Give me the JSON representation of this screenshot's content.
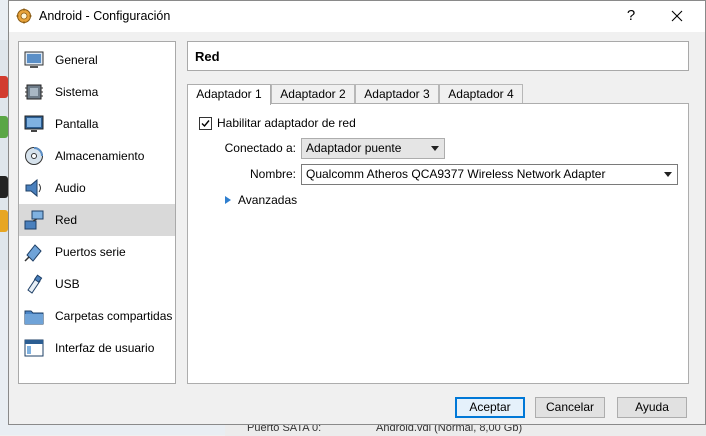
{
  "window": {
    "title": "Android - Configuración",
    "help_glyph": "?",
    "close_glyph": "✕"
  },
  "sidebar": {
    "items": [
      {
        "label": "General",
        "icon": "general-icon"
      },
      {
        "label": "Sistema",
        "icon": "chip-icon"
      },
      {
        "label": "Pantalla",
        "icon": "monitor-icon"
      },
      {
        "label": "Almacenamiento",
        "icon": "disk-icon"
      },
      {
        "label": "Audio",
        "icon": "speaker-icon"
      },
      {
        "label": "Red",
        "icon": "network-icon",
        "selected": true
      },
      {
        "label": "Puertos serie",
        "icon": "serial-port-icon"
      },
      {
        "label": "USB",
        "icon": "usb-icon"
      },
      {
        "label": "Carpetas compartidas",
        "icon": "folder-icon"
      },
      {
        "label": "Interfaz de usuario",
        "icon": "window-icon"
      }
    ]
  },
  "header": {
    "title": "Red"
  },
  "tabs": [
    {
      "label": "Adaptador 1",
      "active": true
    },
    {
      "label": "Adaptador 2"
    },
    {
      "label": "Adaptador 3"
    },
    {
      "label": "Adaptador 4"
    }
  ],
  "adapter": {
    "enable_label": "Habilitar adaptador de red",
    "enabled": true,
    "attached_label": "Conectado a:",
    "attached_value": "Adaptador puente",
    "name_label": "Nombre:",
    "name_value": "Qualcomm Atheros QCA9377 Wireless Network Adapter",
    "advanced_label": "Avanzadas"
  },
  "buttons": {
    "accept": "Aceptar",
    "cancel": "Cancelar",
    "help": "Ayuda"
  },
  "background": {
    "port_label": "Puerto SATA 0:",
    "disk_value": "Android.vdi (Normal, 8,00 Gb)"
  },
  "colors": {
    "accent": "#0078d7",
    "expander": "#2f7fcf",
    "selection": "#d9d9d9"
  }
}
